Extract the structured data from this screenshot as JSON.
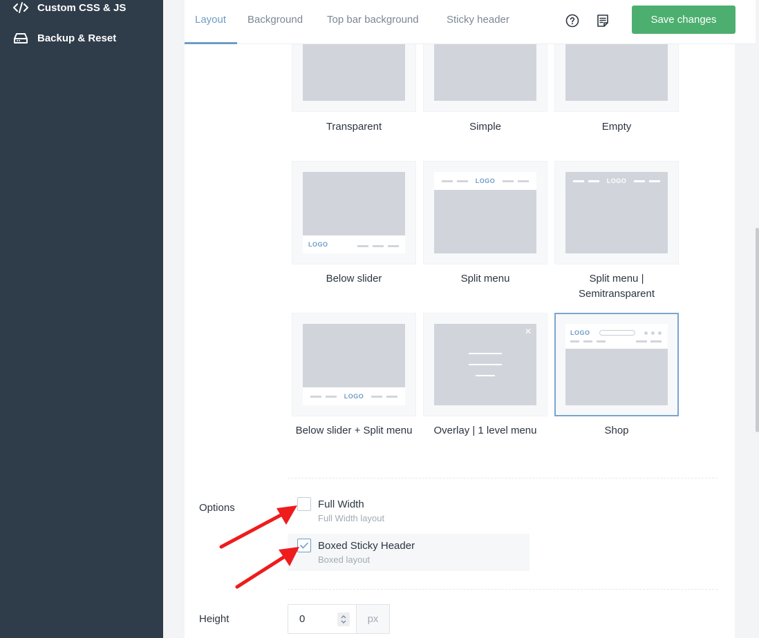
{
  "sidebar": {
    "items": [
      {
        "label": "Custom CSS & JS",
        "icon": "code-icon"
      },
      {
        "label": "Backup & Reset",
        "icon": "drive-icon"
      }
    ]
  },
  "topbar": {
    "tabs": [
      {
        "label": "Layout",
        "active": true
      },
      {
        "label": "Background",
        "active": false
      },
      {
        "label": "Top bar background",
        "active": false
      },
      {
        "label": "Sticky header",
        "active": false
      }
    ],
    "save_label": "Save changes"
  },
  "layouts": [
    {
      "label": "Transparent",
      "selected": false
    },
    {
      "label": "Simple",
      "selected": false
    },
    {
      "label": "Empty",
      "selected": false
    },
    {
      "label": "Below slider",
      "selected": false,
      "logo": "LOGO"
    },
    {
      "label": "Split menu",
      "selected": false,
      "logo": "LOGO"
    },
    {
      "label_line1": "Split menu |",
      "label_line2": "Semitransparent",
      "selected": false,
      "logo": "LOGO"
    },
    {
      "label": "Below slider + Split menu",
      "selected": false,
      "logo": "LOGO"
    },
    {
      "label": "Overlay | 1 level menu",
      "selected": false
    },
    {
      "label": "Shop",
      "selected": true,
      "logo": "LOGO"
    }
  ],
  "options": {
    "label": "Options",
    "full_width": {
      "title": "Full Width",
      "desc": "Full Width layout",
      "checked": false
    },
    "boxed": {
      "title": "Boxed Sticky Header",
      "desc": "Boxed layout",
      "checked": true
    }
  },
  "height": {
    "label": "Height",
    "value": "0",
    "unit": "px"
  },
  "colors": {
    "sidebar_bg": "#2f3c4a",
    "accent": "#6e9bc7",
    "save_green": "#4caf6f",
    "annotation_arrow": "#ee1c1c"
  }
}
